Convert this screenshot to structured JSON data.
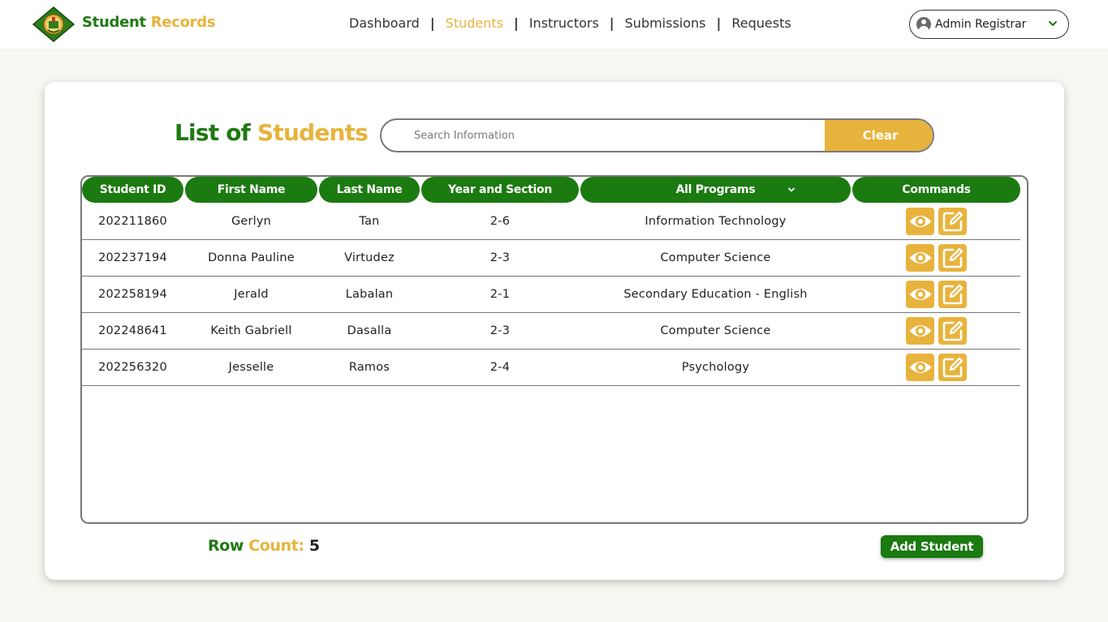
{
  "app": {
    "brand_part1": "Student",
    "brand_part2": "Records"
  },
  "nav": {
    "items": [
      {
        "label": "Dashboard",
        "active": false
      },
      {
        "label": "Students",
        "active": true
      },
      {
        "label": "Instructors",
        "active": false
      },
      {
        "label": "Submissions",
        "active": false
      },
      {
        "label": "Requests",
        "active": false
      }
    ],
    "separator": "|"
  },
  "user": {
    "name": "Admin Registrar"
  },
  "page": {
    "title_part1": "List of",
    "title_part2": "Students"
  },
  "search": {
    "placeholder": "Search Information",
    "value": "",
    "clear_label": "Clear"
  },
  "table": {
    "headers": {
      "student_id": "Student ID",
      "first_name": "First Name",
      "last_name": "Last Name",
      "year_section": "Year and Section",
      "program_filter": "All Programs",
      "commands": "Commands"
    },
    "rows": [
      {
        "student_id": "202211860",
        "first_name": "Gerlyn",
        "last_name": "Tan",
        "year_section": "2-6",
        "program": "Information Technology"
      },
      {
        "student_id": "202237194",
        "first_name": "Donna Pauline",
        "last_name": "Virtudez",
        "year_section": "2-3",
        "program": "Computer Science"
      },
      {
        "student_id": "202258194",
        "first_name": "Jerald",
        "last_name": "Labalan",
        "year_section": "2-1",
        "program": "Secondary Education - English"
      },
      {
        "student_id": "202248641",
        "first_name": "Keith Gabriell",
        "last_name": "Dasalla",
        "year_section": "2-3",
        "program": "Computer Science"
      },
      {
        "student_id": "202256320",
        "first_name": "Jesselle",
        "last_name": "Ramos",
        "year_section": "2-4",
        "program": "Psychology"
      }
    ],
    "command_icons": [
      "eye-icon",
      "edit-icon"
    ]
  },
  "footer": {
    "row_count_part1": "Row",
    "row_count_part2": "Count:",
    "row_count_value": "5",
    "add_label": "Add Student"
  },
  "colors": {
    "green": "#1f7a12",
    "gold": "#e8b33c",
    "background": "#f6f7f1"
  }
}
